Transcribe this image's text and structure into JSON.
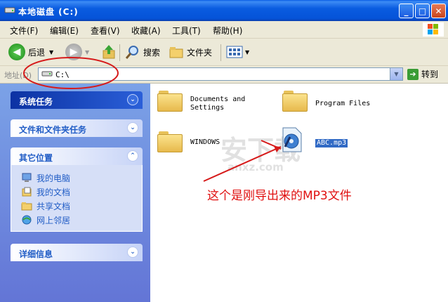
{
  "window": {
    "title": "本地磁盘 (C:)",
    "caption_buttons": {
      "minimize": "_",
      "maximize": "□",
      "close": "✕"
    }
  },
  "menu": {
    "items": [
      "文件(F)",
      "编辑(E)",
      "查看(V)",
      "收藏(A)",
      "工具(T)",
      "帮助(H)"
    ]
  },
  "toolbar": {
    "back_label": "后退",
    "search_label": "搜索",
    "folders_label": "文件夹"
  },
  "address": {
    "label": "地址(D)",
    "value": "C:\\",
    "go_label": "转到"
  },
  "sidebar": {
    "system_tasks": "系统任务",
    "file_folder_tasks": "文件和文件夹任务",
    "other_places": {
      "title": "其它位置",
      "items": [
        "我的电脑",
        "我的文档",
        "共享文档",
        "网上邻居"
      ]
    },
    "details": "详细信息"
  },
  "content": {
    "items": [
      {
        "name": "Documents and\nSettings",
        "type": "folder"
      },
      {
        "name": "Program Files",
        "type": "folder"
      },
      {
        "name": "WINDOWS",
        "type": "folder"
      },
      {
        "name": "ABC.mp3",
        "type": "mp3",
        "selected": true
      }
    ]
  },
  "annotation": {
    "text": "这个是刚导出来的MP3文件",
    "color": "#e01010"
  },
  "watermark": {
    "text": "安下载",
    "subtext": "anxz.com"
  },
  "colors": {
    "titlebar": "#0a5ce0",
    "sidebar": "#7ba2e7",
    "selection": "#316ac5",
    "annotation": "#e01010"
  }
}
